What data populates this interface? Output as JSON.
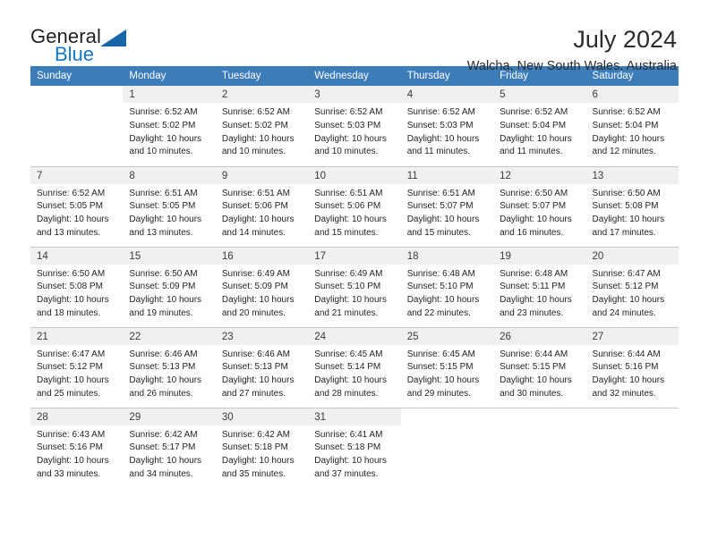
{
  "logo": {
    "primary_text": "General",
    "secondary_text": "Blue",
    "primary_color": "#231f20",
    "secondary_color": "#1279c6",
    "triangle_color": "#1565a8"
  },
  "header": {
    "title": "July 2024",
    "subtitle": "Walcha, New South Wales, Australia"
  },
  "theme": {
    "header_bg": "#3b7cb9",
    "header_text": "#ffffff",
    "daynum_bg": "#f0f0f0",
    "cell_bg": "#ffffff",
    "grid_line": "#c8c8c8"
  },
  "calendar": {
    "weekday_headers": [
      "Sunday",
      "Monday",
      "Tuesday",
      "Wednesday",
      "Thursday",
      "Friday",
      "Saturday"
    ],
    "weeks": [
      [
        {
          "day": "",
          "sunrise": "",
          "sunset": "",
          "daylight": "",
          "daylight_cont": ""
        },
        {
          "day": "1",
          "sunrise": "Sunrise: 6:52 AM",
          "sunset": "Sunset: 5:02 PM",
          "daylight": "Daylight: 10 hours",
          "daylight_cont": "and 10 minutes."
        },
        {
          "day": "2",
          "sunrise": "Sunrise: 6:52 AM",
          "sunset": "Sunset: 5:02 PM",
          "daylight": "Daylight: 10 hours",
          "daylight_cont": "and 10 minutes."
        },
        {
          "day": "3",
          "sunrise": "Sunrise: 6:52 AM",
          "sunset": "Sunset: 5:03 PM",
          "daylight": "Daylight: 10 hours",
          "daylight_cont": "and 10 minutes."
        },
        {
          "day": "4",
          "sunrise": "Sunrise: 6:52 AM",
          "sunset": "Sunset: 5:03 PM",
          "daylight": "Daylight: 10 hours",
          "daylight_cont": "and 11 minutes."
        },
        {
          "day": "5",
          "sunrise": "Sunrise: 6:52 AM",
          "sunset": "Sunset: 5:04 PM",
          "daylight": "Daylight: 10 hours",
          "daylight_cont": "and 11 minutes."
        },
        {
          "day": "6",
          "sunrise": "Sunrise: 6:52 AM",
          "sunset": "Sunset: 5:04 PM",
          "daylight": "Daylight: 10 hours",
          "daylight_cont": "and 12 minutes."
        }
      ],
      [
        {
          "day": "7",
          "sunrise": "Sunrise: 6:52 AM",
          "sunset": "Sunset: 5:05 PM",
          "daylight": "Daylight: 10 hours",
          "daylight_cont": "and 13 minutes."
        },
        {
          "day": "8",
          "sunrise": "Sunrise: 6:51 AM",
          "sunset": "Sunset: 5:05 PM",
          "daylight": "Daylight: 10 hours",
          "daylight_cont": "and 13 minutes."
        },
        {
          "day": "9",
          "sunrise": "Sunrise: 6:51 AM",
          "sunset": "Sunset: 5:06 PM",
          "daylight": "Daylight: 10 hours",
          "daylight_cont": "and 14 minutes."
        },
        {
          "day": "10",
          "sunrise": "Sunrise: 6:51 AM",
          "sunset": "Sunset: 5:06 PM",
          "daylight": "Daylight: 10 hours",
          "daylight_cont": "and 15 minutes."
        },
        {
          "day": "11",
          "sunrise": "Sunrise: 6:51 AM",
          "sunset": "Sunset: 5:07 PM",
          "daylight": "Daylight: 10 hours",
          "daylight_cont": "and 15 minutes."
        },
        {
          "day": "12",
          "sunrise": "Sunrise: 6:50 AM",
          "sunset": "Sunset: 5:07 PM",
          "daylight": "Daylight: 10 hours",
          "daylight_cont": "and 16 minutes."
        },
        {
          "day": "13",
          "sunrise": "Sunrise: 6:50 AM",
          "sunset": "Sunset: 5:08 PM",
          "daylight": "Daylight: 10 hours",
          "daylight_cont": "and 17 minutes."
        }
      ],
      [
        {
          "day": "14",
          "sunrise": "Sunrise: 6:50 AM",
          "sunset": "Sunset: 5:08 PM",
          "daylight": "Daylight: 10 hours",
          "daylight_cont": "and 18 minutes."
        },
        {
          "day": "15",
          "sunrise": "Sunrise: 6:50 AM",
          "sunset": "Sunset: 5:09 PM",
          "daylight": "Daylight: 10 hours",
          "daylight_cont": "and 19 minutes."
        },
        {
          "day": "16",
          "sunrise": "Sunrise: 6:49 AM",
          "sunset": "Sunset: 5:09 PM",
          "daylight": "Daylight: 10 hours",
          "daylight_cont": "and 20 minutes."
        },
        {
          "day": "17",
          "sunrise": "Sunrise: 6:49 AM",
          "sunset": "Sunset: 5:10 PM",
          "daylight": "Daylight: 10 hours",
          "daylight_cont": "and 21 minutes."
        },
        {
          "day": "18",
          "sunrise": "Sunrise: 6:48 AM",
          "sunset": "Sunset: 5:10 PM",
          "daylight": "Daylight: 10 hours",
          "daylight_cont": "and 22 minutes."
        },
        {
          "day": "19",
          "sunrise": "Sunrise: 6:48 AM",
          "sunset": "Sunset: 5:11 PM",
          "daylight": "Daylight: 10 hours",
          "daylight_cont": "and 23 minutes."
        },
        {
          "day": "20",
          "sunrise": "Sunrise: 6:47 AM",
          "sunset": "Sunset: 5:12 PM",
          "daylight": "Daylight: 10 hours",
          "daylight_cont": "and 24 minutes."
        }
      ],
      [
        {
          "day": "21",
          "sunrise": "Sunrise: 6:47 AM",
          "sunset": "Sunset: 5:12 PM",
          "daylight": "Daylight: 10 hours",
          "daylight_cont": "and 25 minutes."
        },
        {
          "day": "22",
          "sunrise": "Sunrise: 6:46 AM",
          "sunset": "Sunset: 5:13 PM",
          "daylight": "Daylight: 10 hours",
          "daylight_cont": "and 26 minutes."
        },
        {
          "day": "23",
          "sunrise": "Sunrise: 6:46 AM",
          "sunset": "Sunset: 5:13 PM",
          "daylight": "Daylight: 10 hours",
          "daylight_cont": "and 27 minutes."
        },
        {
          "day": "24",
          "sunrise": "Sunrise: 6:45 AM",
          "sunset": "Sunset: 5:14 PM",
          "daylight": "Daylight: 10 hours",
          "daylight_cont": "and 28 minutes."
        },
        {
          "day": "25",
          "sunrise": "Sunrise: 6:45 AM",
          "sunset": "Sunset: 5:15 PM",
          "daylight": "Daylight: 10 hours",
          "daylight_cont": "and 29 minutes."
        },
        {
          "day": "26",
          "sunrise": "Sunrise: 6:44 AM",
          "sunset": "Sunset: 5:15 PM",
          "daylight": "Daylight: 10 hours",
          "daylight_cont": "and 30 minutes."
        },
        {
          "day": "27",
          "sunrise": "Sunrise: 6:44 AM",
          "sunset": "Sunset: 5:16 PM",
          "daylight": "Daylight: 10 hours",
          "daylight_cont": "and 32 minutes."
        }
      ],
      [
        {
          "day": "28",
          "sunrise": "Sunrise: 6:43 AM",
          "sunset": "Sunset: 5:16 PM",
          "daylight": "Daylight: 10 hours",
          "daylight_cont": "and 33 minutes."
        },
        {
          "day": "29",
          "sunrise": "Sunrise: 6:42 AM",
          "sunset": "Sunset: 5:17 PM",
          "daylight": "Daylight: 10 hours",
          "daylight_cont": "and 34 minutes."
        },
        {
          "day": "30",
          "sunrise": "Sunrise: 6:42 AM",
          "sunset": "Sunset: 5:18 PM",
          "daylight": "Daylight: 10 hours",
          "daylight_cont": "and 35 minutes."
        },
        {
          "day": "31",
          "sunrise": "Sunrise: 6:41 AM",
          "sunset": "Sunset: 5:18 PM",
          "daylight": "Daylight: 10 hours",
          "daylight_cont": "and 37 minutes."
        },
        {
          "day": "",
          "sunrise": "",
          "sunset": "",
          "daylight": "",
          "daylight_cont": ""
        },
        {
          "day": "",
          "sunrise": "",
          "sunset": "",
          "daylight": "",
          "daylight_cont": ""
        },
        {
          "day": "",
          "sunrise": "",
          "sunset": "",
          "daylight": "",
          "daylight_cont": ""
        }
      ]
    ]
  }
}
